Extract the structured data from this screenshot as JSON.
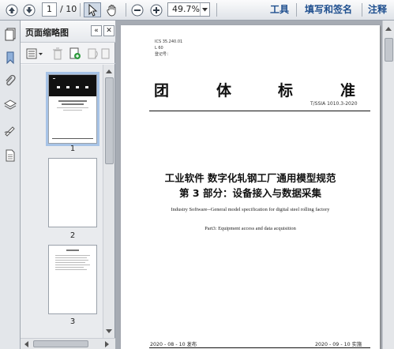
{
  "toolbar": {
    "page_current": "1",
    "page_total": "/ 10",
    "zoom": "49.7%",
    "menu": {
      "tools": "工具",
      "fill_sign": "填写和签名",
      "comment": "注释"
    }
  },
  "thumbnail_panel": {
    "title": "页面缩略图",
    "pages": [
      "1",
      "2",
      "3"
    ]
  },
  "document": {
    "header_lines": [
      "ICS 35.240.01",
      "L 60",
      "登记号："
    ],
    "title_chars": [
      "团",
      "体",
      "标",
      "准"
    ],
    "standard_number": "T/SSIA 1010.3-2020",
    "title_line1": "工业软件   数字化轧钢工厂通用模型规范",
    "title_line2": "第 3 部分：设备接入与数据采集",
    "english_title": "Industry Software--General model specification for digital steel rolling factory",
    "english_part": "Part3: Equipment access and data acquisition",
    "publish_date": "2020 - 08 - 10 发布",
    "effective_date": "2020 - 09 - 10 实施"
  },
  "colors": {
    "menu_text": "#1f4f8f",
    "background": "#a6abb3"
  }
}
